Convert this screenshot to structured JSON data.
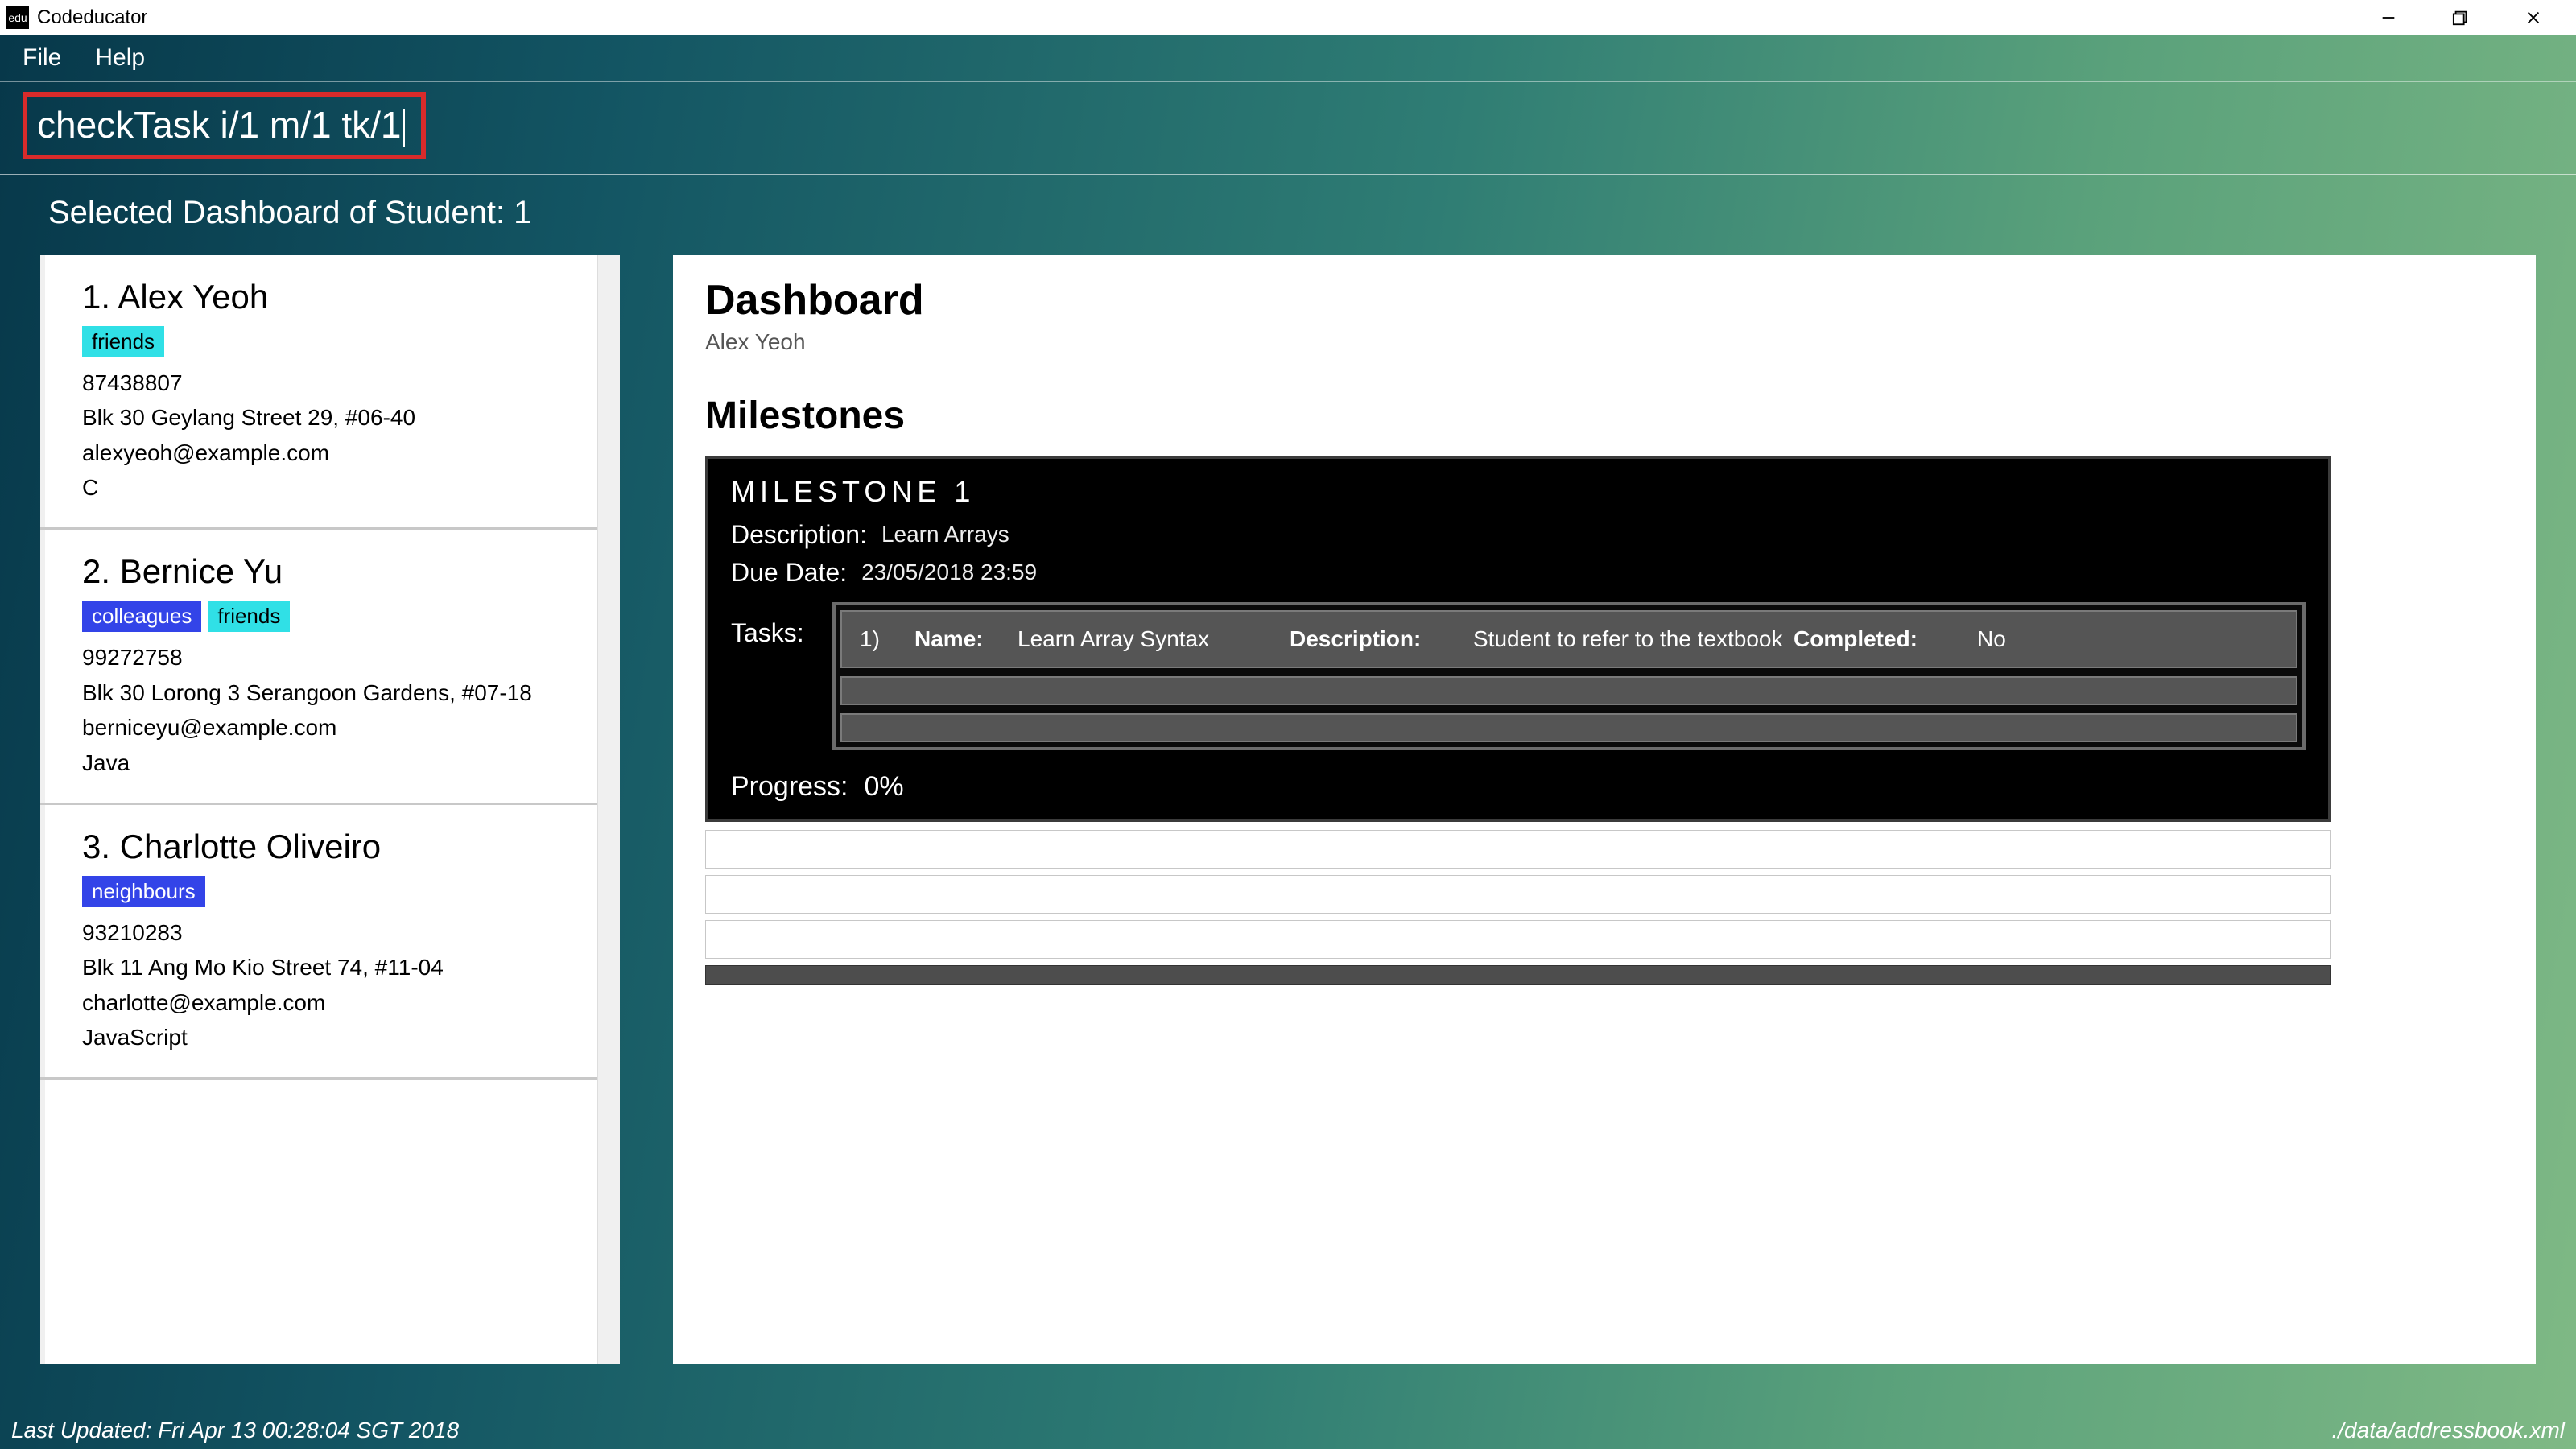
{
  "window": {
    "title": "Codeducator",
    "icon_text": "edu"
  },
  "menu": {
    "file": "File",
    "help": "Help"
  },
  "command": {
    "text": "checkTask i/1 m/1 tk/1"
  },
  "subtitle": "Selected Dashboard of Student: 1",
  "students": [
    {
      "index": "1.",
      "name": "Alex Yeoh",
      "tags": [
        {
          "label": "friends",
          "color": "cyan"
        }
      ],
      "phone": "87438807",
      "address": "Blk 30 Geylang Street 29, #06-40",
      "email": "alexyeoh@example.com",
      "lang": "C"
    },
    {
      "index": "2.",
      "name": "Bernice Yu",
      "tags": [
        {
          "label": "colleagues",
          "color": "blue"
        },
        {
          "label": "friends",
          "color": "cyan"
        }
      ],
      "phone": "99272758",
      "address": "Blk 30 Lorong 3 Serangoon Gardens, #07-18",
      "email": "berniceyu@example.com",
      "lang": "Java"
    },
    {
      "index": "3.",
      "name": "Charlotte Oliveiro",
      "tags": [
        {
          "label": "neighbours",
          "color": "blue"
        }
      ],
      "phone": "93210283",
      "address": "Blk 11 Ang Mo Kio Street 74, #11-04",
      "email": "charlotte@example.com",
      "lang": "JavaScript"
    }
  ],
  "dashboard": {
    "title": "Dashboard",
    "student": "Alex Yeoh",
    "section": "Milestones",
    "milestone": {
      "header": "MILESTONE 1",
      "desc_label": "Description:",
      "desc_value": "Learn Arrays",
      "due_label": "Due Date:",
      "due_value": "23/05/2018 23:59",
      "tasks_label": "Tasks:",
      "task": {
        "num": "1)",
        "name_label": "Name:",
        "name_value": "Learn Array Syntax",
        "desc_label": "Description:",
        "desc_value": "Student to refer to the textbook",
        "completed_label": "Completed:",
        "completed_value": "No"
      },
      "progress_label": "Progress:",
      "progress_value": "0%"
    }
  },
  "status": {
    "left": "Last Updated: Fri Apr 13 00:28:04 SGT 2018",
    "right": "./data/addressbook.xml"
  }
}
